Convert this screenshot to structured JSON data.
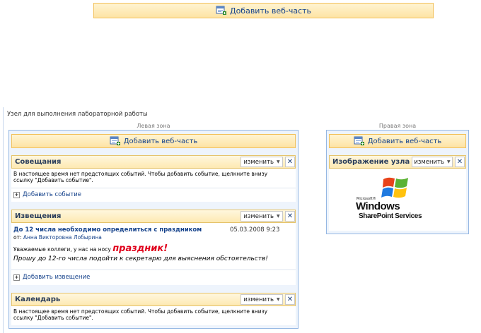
{
  "top_add_webpart": "Добавить веб-часть",
  "site_title": "Узел для выполнения лабораторной работы",
  "left_zone": {
    "label": "Левая зона",
    "add_webpart": "Добавить веб-часть",
    "meetings": {
      "title": "Совещания",
      "edit": "изменить",
      "close": "✕",
      "empty_line1": "В настоящее время нет предстоящих событий. Чтобы добавить событие, щелкните внизу",
      "empty_line2": "ссылку \"Добавить событие\".",
      "add_link": "Добавить событие"
    },
    "announcements": {
      "title": "Извещения",
      "edit": "изменить",
      "close": "✕",
      "item_title": "До 12 числа необходимо определиться с праздником",
      "item_date": "05.03.2008 9:23",
      "item_from_label": "от: ",
      "item_author": "Анна Викторовна Лобырина",
      "body_prefix": "Уважаемые коллеги, у нас на носу ",
      "body_highlight": "праздник!",
      "body_line2": "Прошу до 12-го числа подойти к секретарю для выяснения обстоятельств!",
      "add_link": "Добавить извещение"
    },
    "calendar": {
      "title": "Календарь",
      "edit": "изменить",
      "close": "✕",
      "empty_line1": "В настоящее время нет предстоящих событий. Чтобы добавить событие, щелкните внизу",
      "empty_line2": "ссылку \"Добавить событие\"."
    }
  },
  "right_zone": {
    "label": "Правая зона",
    "add_webpart": "Добавить веб-часть",
    "site_image": {
      "title": "Изображение узла",
      "edit": "изменить",
      "close": "✕",
      "logo_microsoft": "Microsoft®",
      "logo_windows": "Windows",
      "logo_sharepoint": "SharePoint Services"
    }
  },
  "colors": {
    "link": "#15428b",
    "highlight": "#e0001b",
    "zone_border": "#95b7e3"
  }
}
